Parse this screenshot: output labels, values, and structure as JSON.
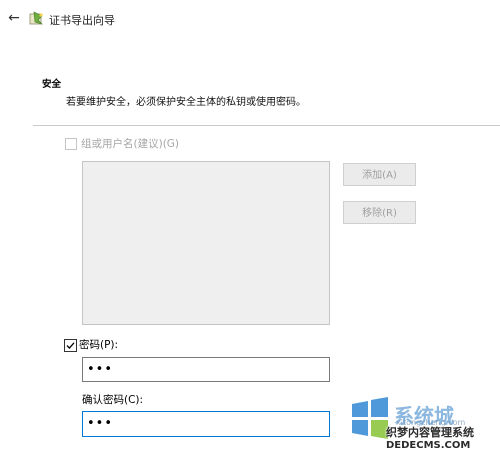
{
  "header": {
    "back_icon": "back-arrow-icon",
    "wizard_icon": "certificate-wizard-icon",
    "title": "证书导出向导"
  },
  "security": {
    "heading": "安全",
    "description": "若要维护安全，必须保护安全主体的私钥或使用密码。"
  },
  "group_option": {
    "label": "组或用户名(建议)(G)",
    "checked": false,
    "enabled": false
  },
  "buttons": {
    "add_label": "添加(A)",
    "remove_label": "移除(R)"
  },
  "password": {
    "checkbox_label": "密码(P):",
    "checked": true,
    "value": "•••",
    "confirm_label": "确认密码(C):",
    "confirm_value": "•••"
  },
  "watermark": {
    "brand": "系统城",
    "url1": "xitongcheng.com",
    "site": "织梦内容管理系统",
    "url2": "DEDECMS.COM"
  },
  "colors": {
    "focus_border": "#0078d7",
    "disabled_text": "#a6a6a6",
    "listbox_bg": "#efefef"
  }
}
